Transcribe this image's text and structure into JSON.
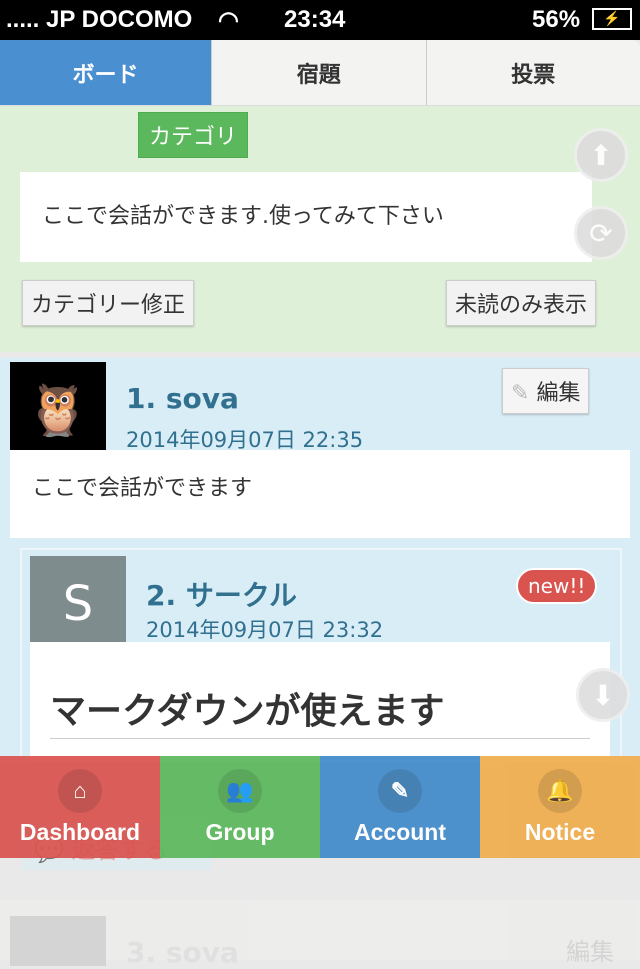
{
  "status": {
    "carrier": "JP DOCOMO",
    "time": "23:34",
    "battery": "56%"
  },
  "tabs": [
    {
      "label": "ボード",
      "active": true
    },
    {
      "label": "宿題"
    },
    {
      "label": "投票"
    }
  ],
  "board": {
    "category_label": "カテゴリ",
    "description": "ここで会話ができます.使ってみて下さい",
    "edit_category": "カテゴリー修正",
    "unread_only": "未読のみ表示"
  },
  "posts": [
    {
      "title": "1. sova",
      "date": "2014年09月07日 22:35",
      "body": "ここで会話ができます",
      "edit": "編集"
    },
    {
      "avatar_letter": "S",
      "title": "2. サークル",
      "date": "2014年09月07日 23:32",
      "badge": "new!!",
      "body": "マークダウンが使えます"
    },
    {
      "title": "3. sova",
      "edit": "編集"
    }
  ],
  "reply_label": "返答する",
  "nav": [
    {
      "label": "Dashboard",
      "icon": "home",
      "color": "#d9534f"
    },
    {
      "label": "Group",
      "icon": "users",
      "color": "#5cb85c"
    },
    {
      "label": "Account",
      "icon": "edit",
      "color": "#428bca"
    },
    {
      "label": "Notice",
      "icon": "bell",
      "color": "#f0ad4e"
    }
  ]
}
